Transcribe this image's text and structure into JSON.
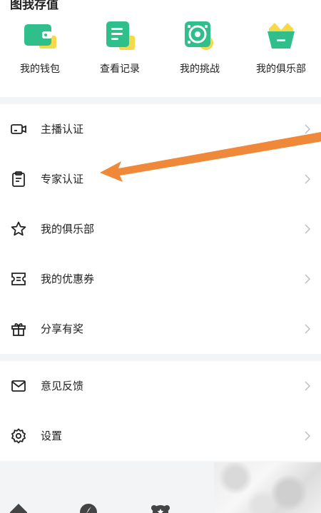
{
  "header": {
    "section_title": "图我存值"
  },
  "shortcuts": [
    {
      "label": "我的钱包",
      "icon": "wallet-icon"
    },
    {
      "label": "查看记录",
      "icon": "records-icon"
    },
    {
      "label": "我的挑战",
      "icon": "challenge-icon"
    },
    {
      "label": "我的俱乐部",
      "icon": "club-crown-icon"
    }
  ],
  "menu_group_1": [
    {
      "label": "主播认证",
      "icon": "broadcaster-camera-icon"
    },
    {
      "label": "专家认证",
      "icon": "expert-clipboard-icon"
    },
    {
      "label": "我的俱乐部",
      "icon": "star-icon"
    },
    {
      "label": "我的优惠券",
      "icon": "coupon-icon"
    },
    {
      "label": "分享有奖",
      "icon": "gift-icon"
    }
  ],
  "menu_group_2": [
    {
      "label": "意见反馈",
      "icon": "mail-icon"
    },
    {
      "label": "设置",
      "icon": "gear-icon"
    }
  ],
  "colors": {
    "brand_green": "#2fbf8a",
    "accent_yellow": "#f5d94a",
    "annotation_arrow": "#f0883a"
  }
}
